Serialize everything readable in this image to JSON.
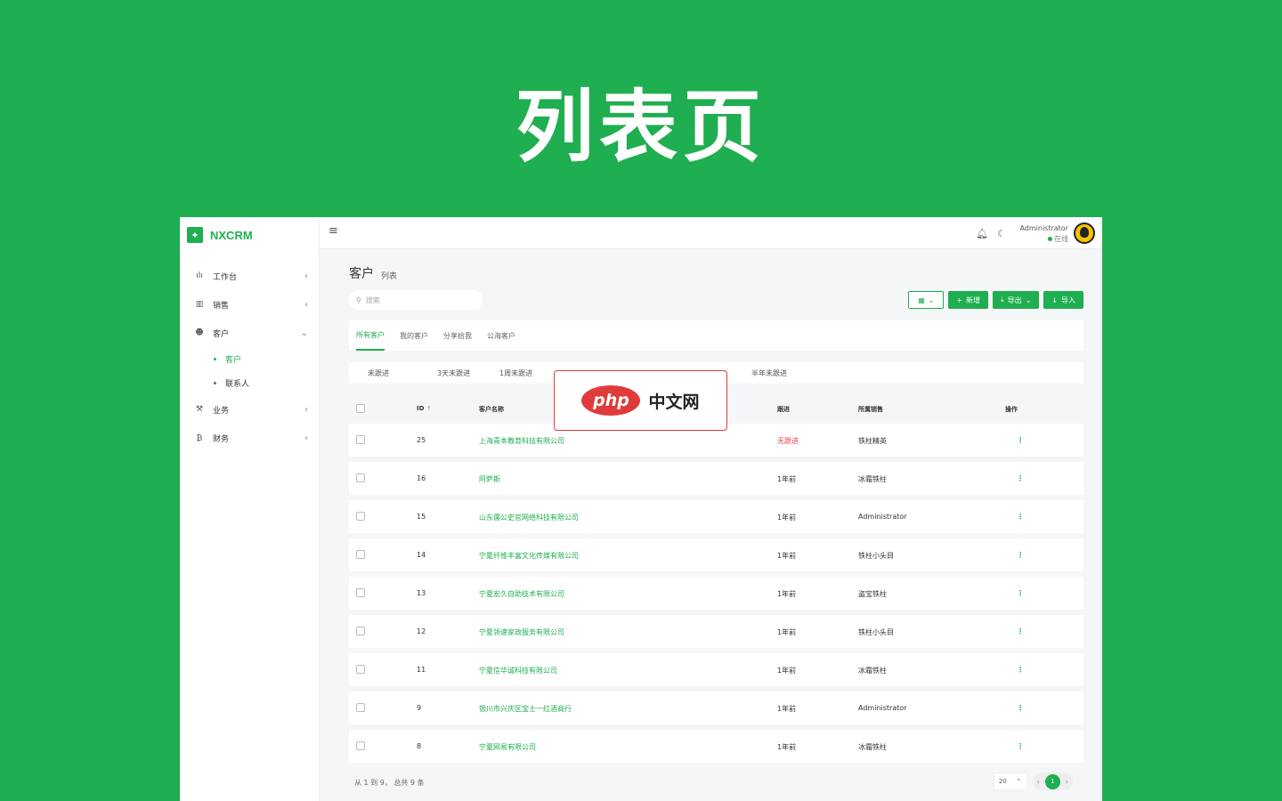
{
  "hero": {
    "title": "列表页"
  },
  "brand": {
    "name": "NXCRM",
    "color": "#1fae50"
  },
  "sidebar": {
    "items": [
      {
        "label": "工作台",
        "icon": "dashboard-icon",
        "arrow": "‹"
      },
      {
        "label": "销售",
        "icon": "bar-chart-icon",
        "arrow": "‹"
      },
      {
        "label": "客户",
        "icon": "users-icon",
        "arrow": "⌄"
      }
    ],
    "sub_items": [
      {
        "label": "客户",
        "active": true
      },
      {
        "label": "联系人",
        "active": false
      }
    ],
    "items_after": [
      {
        "label": "业务",
        "icon": "gavel-icon",
        "arrow": "‹"
      },
      {
        "label": "财务",
        "icon": "bitcoin-icon",
        "arrow": "‹"
      }
    ]
  },
  "header": {
    "user_name": "Administrator",
    "user_status": "在线"
  },
  "page": {
    "title": "客户",
    "subtitle": "列表",
    "search_placeholder": "搜索"
  },
  "actions": {
    "new_label": "新增",
    "export_label": "导出",
    "import_label": "导入"
  },
  "tabs": [
    "所有客户",
    "我的客户",
    "分享给我",
    "公海客户"
  ],
  "filters": [
    "未跟进",
    "3天未跟进",
    "1周未跟进",
    "半年未跟进"
  ],
  "table": {
    "headers": {
      "id": "ID",
      "name": "客户名称",
      "follow": "跟进",
      "sales": "所属销售",
      "ops": "操作"
    },
    "rows": [
      {
        "id": "25",
        "name": "上海青本教育科技有限公司",
        "follow": "无跟进",
        "sales": "铁柱精英"
      },
      {
        "id": "16",
        "name": "阿萨斯",
        "follow": "1年前",
        "sales": "冰霜铁柱"
      },
      {
        "id": "15",
        "name": "山东儒公史官网络科技有限公司",
        "follow": "1年前",
        "sales": "Administrator"
      },
      {
        "id": "14",
        "name": "宁夏纤维丰富文化传媒有限公司",
        "follow": "1年前",
        "sales": "铁柱小头目"
      },
      {
        "id": "13",
        "name": "宁夏宏久自助技术有限公司",
        "follow": "1年前",
        "sales": "盗宝铁柱"
      },
      {
        "id": "12",
        "name": "宁夏领速家政服务有限公司",
        "follow": "1年前",
        "sales": "铁柱小头目"
      },
      {
        "id": "11",
        "name": "宁夏信华诚科技有限公司",
        "follow": "1年前",
        "sales": "冰霜铁柱"
      },
      {
        "id": "9",
        "name": "银川市兴庆区宝士一红酒商行",
        "follow": "1年前",
        "sales": "Administrator"
      },
      {
        "id": "8",
        "name": "宁夏网易有限公司",
        "follow": "1年前",
        "sales": "冰霜铁柱"
      }
    ]
  },
  "footer": {
    "summary": "从 1 到 9， 总共 9 条",
    "page_size": "20",
    "current_page": "1"
  },
  "watermark": {
    "logo": "php",
    "text": "中文网"
  }
}
